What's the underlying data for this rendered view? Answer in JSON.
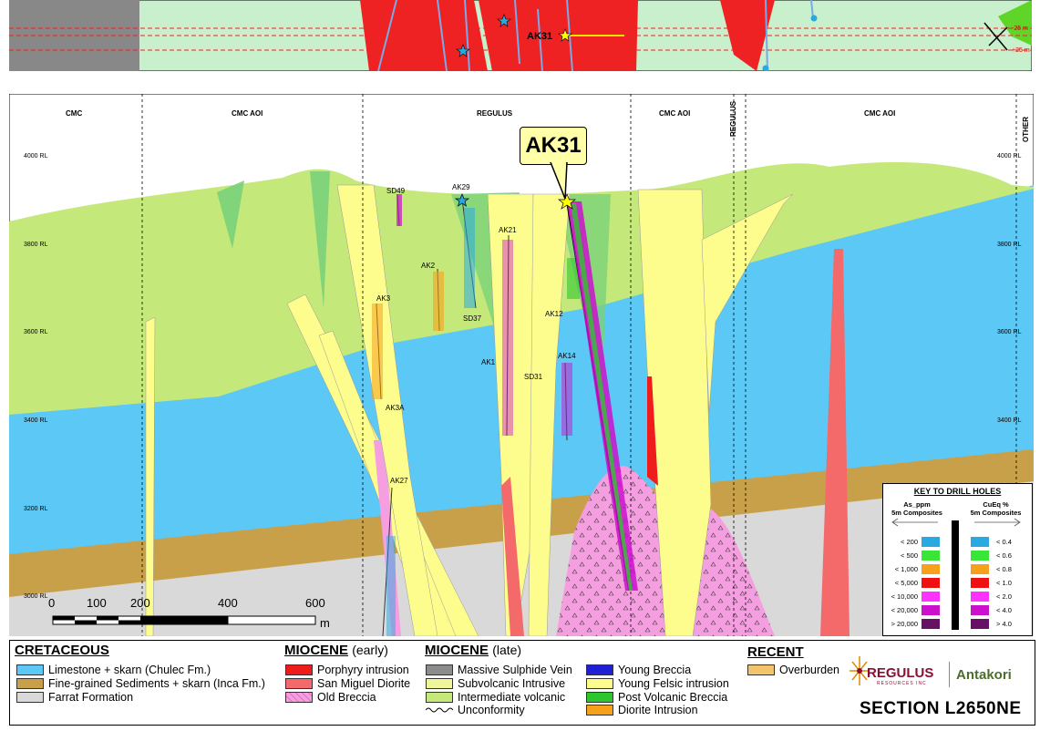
{
  "plan": {
    "label_hole": "AK31",
    "label_m25a": "-25 m",
    "label_m25b": "+25 m"
  },
  "zones": [
    "CMC",
    "CMC AOI",
    "REGULUS",
    "CMC AOI",
    "REGULUS",
    "CMC AOI",
    "OTHER"
  ],
  "rl_left": [
    "4000 RL",
    "3800 RL",
    "3600 RL",
    "3400 RL",
    "3200 RL",
    "3000 RL"
  ],
  "rl_right": [
    "4000 RL",
    "3800 RL",
    "3600 RL",
    "3400 RL"
  ],
  "callout": "AK31",
  "holes": {
    "sd49": "SD49",
    "ak29": "AK29",
    "ak21": "AK21",
    "ak2": "AK2",
    "ak3": "AK3",
    "sd37": "SD37",
    "ak12": "AK12",
    "ak1": "AK1",
    "ak14": "AK14",
    "sd31": "SD31",
    "ak3a": "AK3A",
    "ak27": "AK27"
  },
  "scale": {
    "ticks": [
      "0",
      "100",
      "200",
      "400",
      "600"
    ],
    "unit": "m"
  },
  "key": {
    "title": "KEY TO DRILL HOLES",
    "left_head": "As_ppm\n5m Composites",
    "right_head": "CuEq %\n5m Composites",
    "left_labels": [
      "< 200",
      "< 500",
      "< 1,000",
      "< 5,000",
      "< 10,000",
      "< 20,000",
      "> 20,000"
    ],
    "right_labels": [
      "< 0.4",
      "< 0.6",
      "< 0.8",
      "< 1.0",
      "< 2.0",
      "< 4.0",
      "> 4.0"
    ],
    "colors": [
      "#29a9e1",
      "#39e539",
      "#f7a11a",
      "#ee1111",
      "#ff33ff",
      "#cc11cc",
      "#661166"
    ]
  },
  "legend": {
    "cretaceous": {
      "title": "CRETACEOUS",
      "items": [
        {
          "label": "Limestone + skarn (Chulec Fm.)",
          "color": "#5cc8f5"
        },
        {
          "label": "Fine-grained Sediments + skarn (Inca Fm.)",
          "color": "#c9a04a"
        },
        {
          "label": "Farrat Formation",
          "color": "#d9d9d9"
        }
      ]
    },
    "miocene_early": {
      "title": "MIOCENE",
      "suffix": "(early)",
      "items": [
        {
          "label": "Porphyry intrusion",
          "color": "#ee1c1c"
        },
        {
          "label": "San Miguel Diorite",
          "color": "#f46a6a"
        },
        {
          "label": "Old Breccia",
          "color": "#f59ee0"
        }
      ]
    },
    "miocene_late": {
      "title": "MIOCENE",
      "suffix": "(late)",
      "items_a": [
        {
          "label": "Massive Sulphide Vein",
          "color": "#8c8c8c"
        },
        {
          "label": "Subvolcanic Intrusive",
          "color": "#eef59a"
        },
        {
          "label": "Intermediate volcanic",
          "color": "#c5e87a"
        },
        {
          "label": "Unconformity",
          "color": ""
        }
      ],
      "items_b": [
        {
          "label": "Young Breccia",
          "color": "#1f1fd6"
        },
        {
          "label": "Young Felsic intrusion",
          "color": "#fdfd8e"
        },
        {
          "label": "Post Volcanic Breccia",
          "color": "#2ec62e"
        },
        {
          "label": "Diorite Intrusion",
          "color": "#f7a11a"
        }
      ]
    },
    "recent": {
      "title": "RECENT",
      "items": [
        {
          "label": "Overburden",
          "color": "#f5c36b"
        }
      ]
    }
  },
  "logo": {
    "left": "REGULUS",
    "left_sub": "RESOURCES INC",
    "right": "Antakori"
  },
  "section_title": "SECTION L2650NE"
}
